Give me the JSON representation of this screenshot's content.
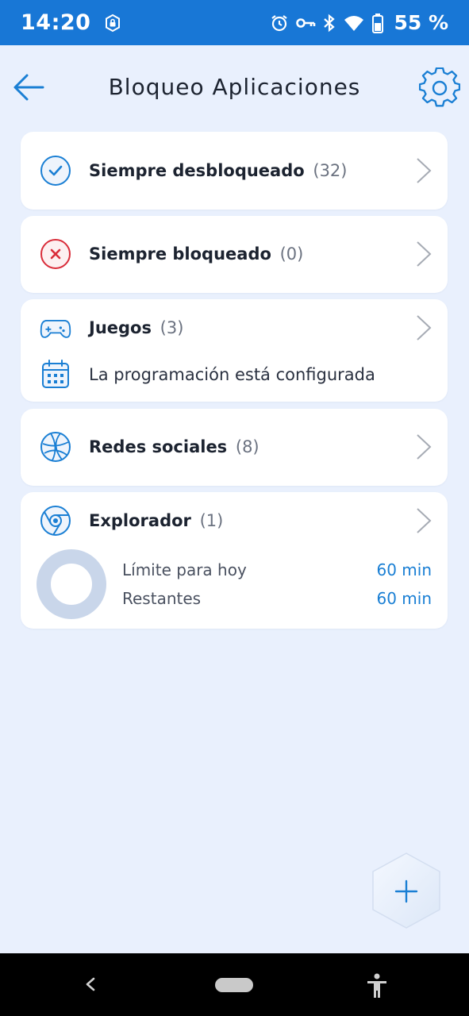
{
  "status_bar": {
    "time": "14:20",
    "battery": "55 %",
    "icons": [
      "lock-app-icon",
      "alarm-icon",
      "vpn-key-icon",
      "bluetooth-icon",
      "wifi-icon",
      "battery-icon"
    ]
  },
  "header": {
    "title": "Bloqueo Aplicaciones",
    "back_icon": "arrow-left-icon",
    "settings_icon": "gear-icon"
  },
  "cards": {
    "always_unlocked": {
      "label": "Siempre desbloqueado",
      "count": "(32)",
      "icon": "check-circle-icon"
    },
    "always_locked": {
      "label": "Siempre bloqueado",
      "count": "(0)",
      "icon": "x-circle-icon"
    },
    "games": {
      "label": "Juegos",
      "count": "(3)",
      "icon": "gamepad-icon",
      "schedule_text": "La programación está configurada",
      "schedule_icon": "calendar-icon"
    },
    "social": {
      "label": "Redes sociales",
      "count": "(8)",
      "icon": "globe-network-icon"
    },
    "explorer": {
      "label": "Explorador",
      "count": "(1)",
      "icon": "browser-icon",
      "limit_label": "Límite para hoy",
      "limit_value": "60 min",
      "remaining_label": "Restantes",
      "remaining_value": "60 min",
      "usage_fraction": 0
    }
  },
  "fab": {
    "icon": "plus-icon"
  },
  "nav": {
    "icons": [
      "nav-back-icon",
      "nav-home-pill",
      "accessibility-icon"
    ]
  },
  "colors": {
    "status_bar": "#1877d6",
    "background": "#e9f0fd",
    "accent": "#1a7fd4",
    "error": "#d92d3a",
    "card": "#ffffff"
  }
}
